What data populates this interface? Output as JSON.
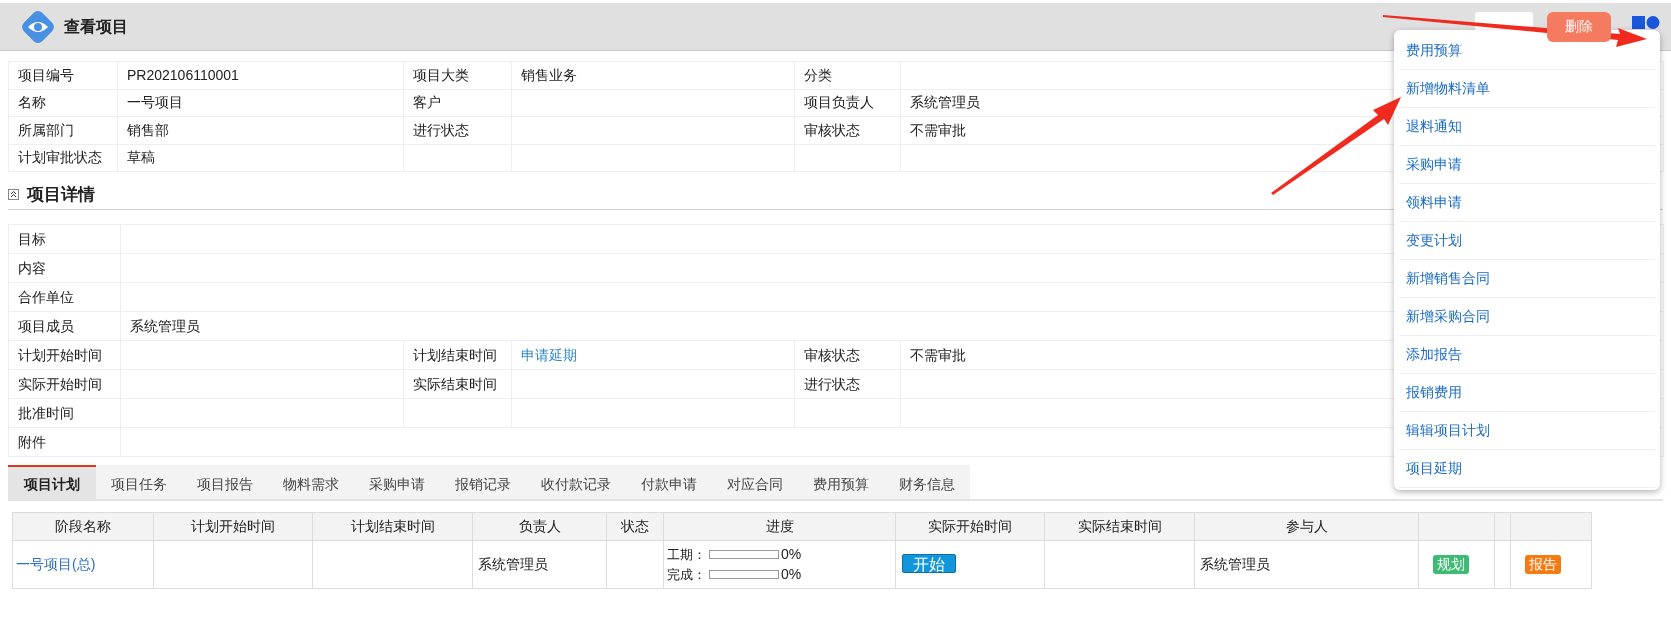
{
  "header": {
    "title": "查看项目",
    "buttons": [
      {
        "kind": "plain"
      },
      {
        "kind": "danger",
        "label": "删除"
      }
    ]
  },
  "info_table": {
    "rows": [
      [
        "项目编号",
        "PR202106110001",
        "项目大类",
        "销售业务",
        "分类",
        ""
      ],
      [
        "名称",
        "一号项目",
        "客户",
        "",
        "项目负责人",
        "系统管理员"
      ],
      [
        "所属部门",
        "销售部",
        "进行状态",
        "",
        "审核状态",
        "不需审批"
      ],
      [
        "计划审批状态",
        "草稿",
        "",
        "",
        "",
        ""
      ]
    ]
  },
  "details": {
    "title": "项目详情",
    "expanded": true,
    "rows": [
      {
        "kind": "wide",
        "cells": [
          "目标"
        ]
      },
      {
        "kind": "wide",
        "cells": [
          "内容"
        ]
      },
      {
        "kind": "wide",
        "cells": [
          "合作单位"
        ]
      },
      {
        "kind": "wide",
        "cells": [
          "项目成员",
          {
            "text": "系统管理员",
            "colspan": 5
          }
        ]
      },
      {
        "kind": "grid",
        "cells": [
          "计划开始时间",
          "",
          "计划结束时间",
          {
            "kind": "link",
            "text": "申请延期"
          },
          "审核状态",
          "不需审批"
        ]
      },
      {
        "kind": "grid",
        "cells": [
          "实际开始时间",
          "",
          "实际结束时间",
          "",
          "进行状态",
          ""
        ]
      },
      {
        "kind": "grid",
        "cells": [
          "批准时间",
          "",
          "",
          "",
          "",
          ""
        ]
      },
      {
        "kind": "wide",
        "cells": [
          "附件"
        ]
      }
    ]
  },
  "tabs": [
    {
      "label": "项目计划",
      "selected": true
    },
    {
      "label": "项目任务",
      "selected": false
    },
    {
      "label": "项目报告",
      "selected": false
    },
    {
      "label": "物料需求",
      "selected": false
    },
    {
      "label": "采购申请",
      "selected": false
    },
    {
      "label": "报销记录",
      "selected": false
    },
    {
      "label": "收付款记录",
      "selected": false
    },
    {
      "label": "付款申请",
      "selected": false
    },
    {
      "label": "对应合同",
      "selected": false
    },
    {
      "label": "费用预算",
      "selected": false
    },
    {
      "label": "财务信息",
      "selected": false
    }
  ],
  "plan_table": {
    "columns": [
      "阶段名称",
      "计划开始时间",
      "计划结束时间",
      "负责人",
      "状态",
      "进度",
      "实际开始时间",
      "实际结束时间",
      "参与人"
    ],
    "rows": [
      {
        "cells": [
          {
            "kind": "link",
            "text": "一号项目(总)"
          },
          {
            "kind": "empty"
          },
          {
            "kind": "empty"
          },
          {
            "kind": "text",
            "text": "系统管理员"
          },
          {
            "kind": "empty"
          },
          {
            "kind": "progress",
            "bars": [
              {
                "label": "工期：",
                "level": 0,
                "reading": "0%"
              },
              {
                "label": "完成：",
                "level": 0,
                "reading": "0%"
              }
            ]
          },
          {
            "kind": "button",
            "text": "开始"
          },
          {
            "kind": "empty"
          },
          {
            "kind": "text",
            "text": "系统管理员"
          },
          {
            "kind": "tag",
            "text": "规划",
            "color": "#3dbb74"
          },
          {
            "kind": "empty"
          },
          {
            "kind": "tag",
            "text": "报告",
            "color": "#f67a12"
          }
        ]
      }
    ]
  },
  "menu": {
    "items": [
      "费用预算",
      "新增物料清单",
      "退料通知",
      "采购申请",
      "领料申请",
      "变更计划",
      "新增销售合同",
      "新增采购合同",
      "添加报告",
      "报销费用",
      "辑辑项目计划",
      "项目延期"
    ]
  }
}
